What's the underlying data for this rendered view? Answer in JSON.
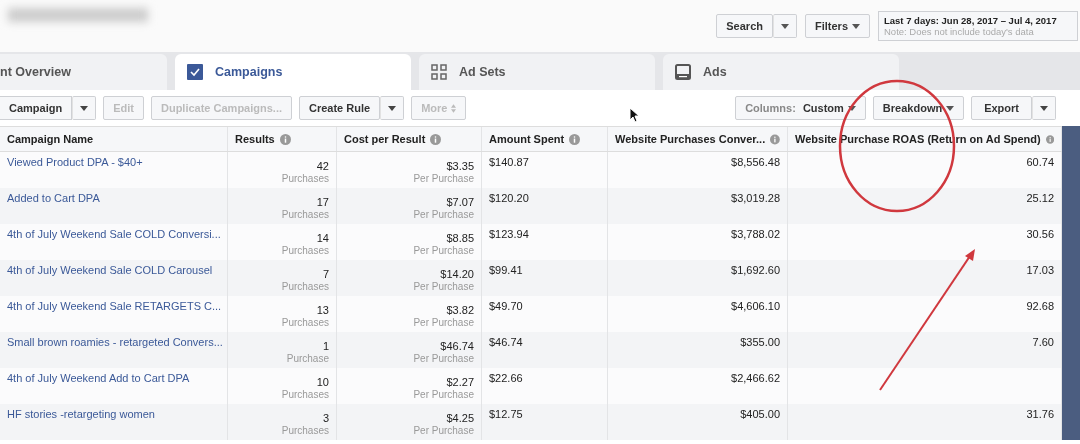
{
  "header": {
    "search_button": "Search",
    "filters_button": "Filters",
    "date_range": {
      "label": "Last 7 days: Jun 28, 2017 – Jul 4, 2017",
      "note": "Note: Does not include today's data"
    }
  },
  "tabs": [
    {
      "label": "nt Overview",
      "kind": "plain",
      "selected": false
    },
    {
      "label": "Campaigns",
      "kind": "checkbox",
      "selected": true
    },
    {
      "label": "Ad Sets",
      "kind": "grid",
      "selected": false
    },
    {
      "label": "Ads",
      "kind": "ad",
      "selected": false
    }
  ],
  "toolbar": {
    "left": [
      {
        "label": "Campaign",
        "caret": true,
        "disabled": false
      },
      {
        "label": "Edit",
        "caret": false,
        "disabled": true
      },
      {
        "label": "Duplicate Campaigns...",
        "caret": false,
        "disabled": true
      },
      {
        "label": "Create Rule",
        "caret": true,
        "disabled": false
      },
      {
        "label": "More",
        "caret": false,
        "updown": true,
        "disabled": true
      }
    ],
    "columns_label": "Columns:",
    "columns_value": "Custom",
    "breakdown": "Breakdown",
    "export": "Export"
  },
  "table": {
    "columns": [
      {
        "label": "Campaign Name",
        "info": false
      },
      {
        "label": "Results",
        "info": true
      },
      {
        "label": "Cost per Result",
        "info": true
      },
      {
        "label": "Amount Spent",
        "info": true
      },
      {
        "label": "Website Purchases Conver...",
        "info": true
      },
      {
        "label": "Website Purchase ROAS (Return on Ad Spend)",
        "info": true
      }
    ],
    "rows": [
      {
        "name": "Viewed Product DPA - $40+",
        "results": "42",
        "result_unit": "Purchases",
        "cost": "$3.35",
        "cost_unit": "Per Purchase",
        "spent": "$140.87",
        "conversion_value": "$8,556.48",
        "roas": "60.74"
      },
      {
        "name": "Added to Cart DPA",
        "results": "17",
        "result_unit": "Purchases",
        "cost": "$7.07",
        "cost_unit": "Per Purchase",
        "spent": "$120.20",
        "conversion_value": "$3,019.28",
        "roas": "25.12"
      },
      {
        "name": "4th of July Weekend Sale COLD Conversi...",
        "results": "14",
        "result_unit": "Purchases",
        "cost": "$8.85",
        "cost_unit": "Per Purchase",
        "spent": "$123.94",
        "conversion_value": "$3,788.02",
        "roas": "30.56"
      },
      {
        "name": "4th of July Weekend Sale COLD Carousel",
        "results": "7",
        "result_unit": "Purchases",
        "cost": "$14.20",
        "cost_unit": "Per Purchase",
        "spent": "$99.41",
        "conversion_value": "$1,692.60",
        "roas": "17.03"
      },
      {
        "name": "4th of July Weekend Sale RETARGETS C...",
        "results": "13",
        "result_unit": "Purchases",
        "cost": "$3.82",
        "cost_unit": "Per Purchase",
        "spent": "$49.70",
        "conversion_value": "$4,606.10",
        "roas": "92.68"
      },
      {
        "name": "Small brown roamies - retargeted Convers...",
        "results": "1",
        "result_unit": "Purchase",
        "cost": "$46.74",
        "cost_unit": "Per Purchase",
        "spent": "$46.74",
        "conversion_value": "$355.00",
        "roas": "7.60"
      },
      {
        "name": "4th of July Weekend Add to Cart DPA",
        "results": "10",
        "result_unit": "Purchases",
        "cost": "$2.27",
        "cost_unit": "Per Purchase",
        "spent": "$22.66",
        "conversion_value": "$2,466.62"
      },
      {
        "name": "HF stories -retargeting women",
        "results": "3",
        "result_unit": "Purchases",
        "cost": "$4.25",
        "cost_unit": "Per Purchase",
        "spent": "$12.75",
        "conversion_value": "$405.00",
        "roas": "31.76"
      }
    ]
  }
}
